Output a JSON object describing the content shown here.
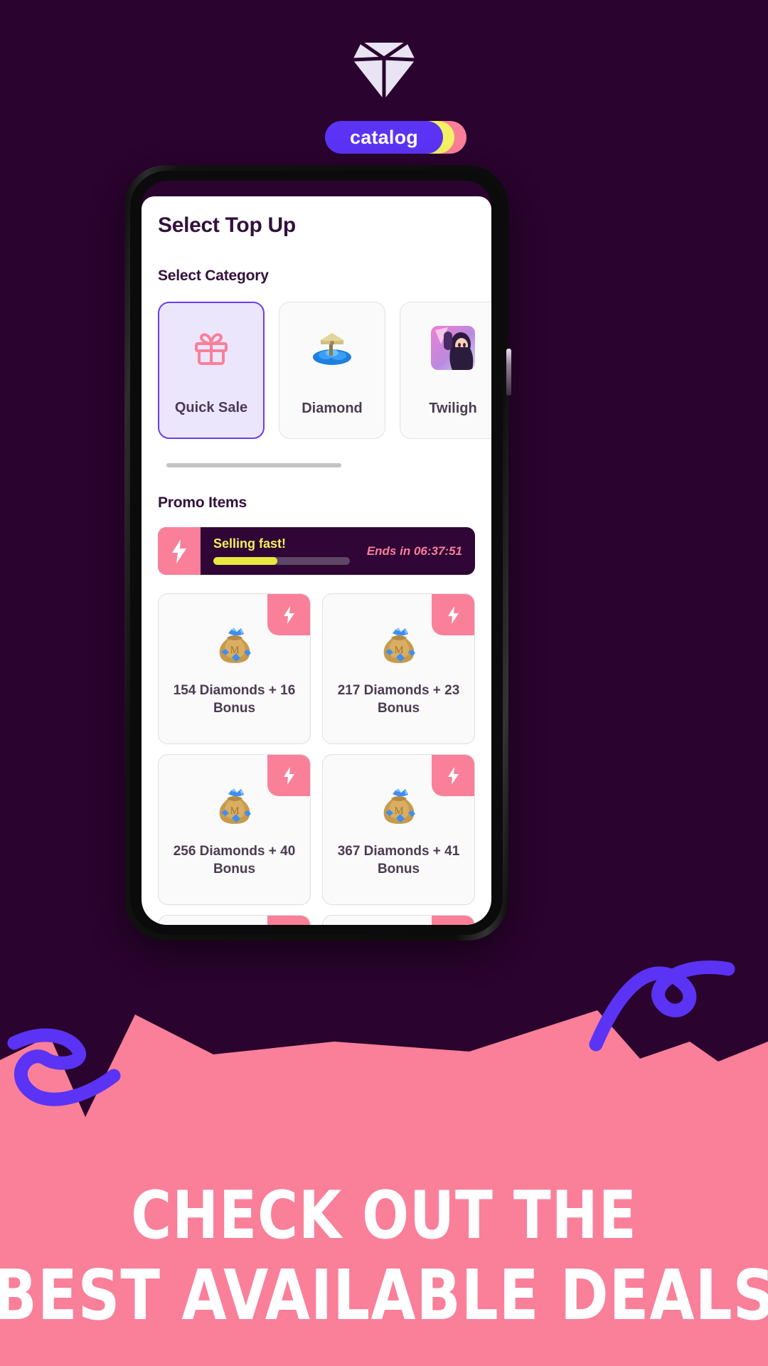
{
  "theme": {
    "background_dark": "#2a032e",
    "background_pink": "#fa7f99",
    "accent_purple": "#5b33f5",
    "accent_yellow": "#f3f263",
    "accent_pink": "#fa7f99"
  },
  "header": {
    "logo_icon": "diamond-icon",
    "badge_label": "catalog"
  },
  "phone": {
    "power_button": "power-button"
  },
  "app": {
    "page_title": "Select Top Up",
    "category_section_title": "Select Category",
    "categories": [
      {
        "label": "Quick Sale",
        "icon": "gift-icon",
        "selected": true
      },
      {
        "label": "Diamond",
        "icon": "diamond-pile-icon",
        "selected": false
      },
      {
        "label": "Twiligh",
        "icon": "character-thumbnail-icon",
        "selected": false
      }
    ],
    "promo_section_title": "Promo Items",
    "promo_banner": {
      "bolt_icon": "lightning-bolt-icon",
      "label": "Selling fast!",
      "countdown": "Ends in 06:37:51",
      "progress_percent": 47
    },
    "products": [
      {
        "label": "154 Diamonds + 16 Bonus",
        "icon": "money-bag-diamonds-icon",
        "flash": true
      },
      {
        "label": "217 Diamonds + 23 Bonus",
        "icon": "money-bag-diamonds-icon",
        "flash": true
      },
      {
        "label": "256 Diamonds + 40 Bonus",
        "icon": "money-bag-diamonds-icon",
        "flash": true
      },
      {
        "label": "367 Diamonds + 41 Bonus",
        "icon": "money-bag-diamonds-icon",
        "flash": true
      },
      {
        "label": "",
        "icon": "treasure-chest-diamonds-icon",
        "flash": true
      },
      {
        "label": "",
        "icon": "treasure-chest-diamonds-icon",
        "flash": true
      }
    ]
  },
  "caption": {
    "line1": "CHECK OUT THE",
    "line2": "BEST AVAILABLE DEALS"
  }
}
